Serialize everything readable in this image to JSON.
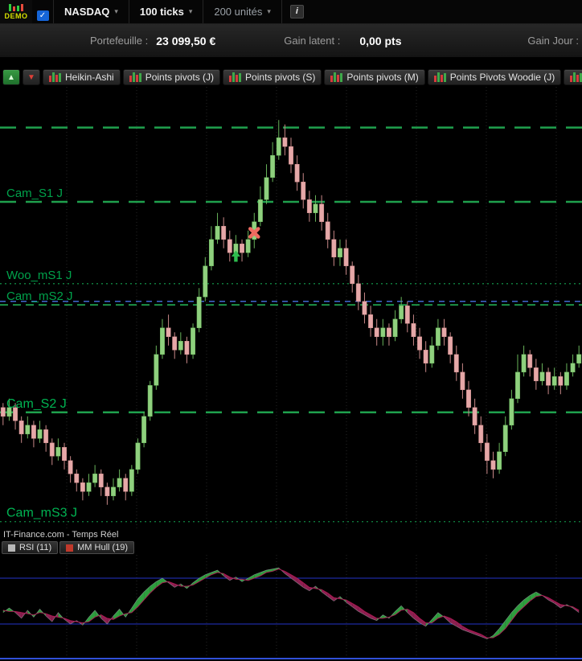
{
  "toolbar": {
    "demo_label": "DEMO",
    "status_icon": "✓",
    "instrument": "NASDAQ",
    "timeframe": "100 ticks",
    "quantity": "200 unités",
    "caret": "▾",
    "info_icon": "i"
  },
  "account": {
    "portfolio_label": "Portefeuille :",
    "portfolio_value": "23 099,50 €",
    "gain_label": "Gain latent :",
    "gain_value": "0,00 pts",
    "day_gain_label": "Gain Jour :"
  },
  "indicator_bar": {
    "up_icon": "▲",
    "down_icon": "▼",
    "buttons": [
      "Heikin-Ashi",
      "Points pivots (J)",
      "Points pivots (S)",
      "Points pivots (M)",
      "Points Pivots Woodie (J)",
      "P"
    ]
  },
  "watermark": "IT-Finance.com - Temps Réel",
  "legend": [
    {
      "label": "RSI (11)",
      "color": "#B8B8B8"
    },
    {
      "label": "MM Hull (19)",
      "color": "#C0392B"
    }
  ],
  "chart_data": {
    "type": "candlestick+oscillator",
    "price": {
      "type": "candlestick",
      "style": "heikin-ashi",
      "range": [
        0,
        100
      ],
      "up_color": "#8FD07E",
      "up_edge": "#68B35A",
      "down_color": "#E6A8A8",
      "down_edge": "#C88888",
      "grid_color": "#262626",
      "grid_start": 83,
      "grid_step": 87,
      "label_color": "#00A24B",
      "label_em_color": "#00B352",
      "level_styles": {
        "long": {
          "color": "#1FA04D",
          "width": 2.5,
          "dash": "20 12"
        },
        "dash": {
          "color": "#1FA04D",
          "width": 1.8,
          "dash": "10 6"
        },
        "dotted": {
          "color": "#0F7A3C",
          "width": 1.4,
          "dash": "2 4"
        },
        "blue": {
          "color": "#4169CF",
          "width": 1.5,
          "dash": "7 6"
        }
      },
      "levels": [
        {
          "label": "",
          "price": 91.3,
          "style": "long"
        },
        {
          "label": "Cam_S1 J",
          "price": 74.5,
          "style": "long"
        },
        {
          "label": "Woo_mS1 J",
          "price": 56.0,
          "style": "dotted"
        },
        {
          "label": "Cam_mS2 J",
          "price": 51.2,
          "style": "dash"
        },
        {
          "label": "",
          "price": 52.0,
          "style": "blue"
        },
        {
          "label": "Cam_S2 J",
          "price": 26.9,
          "style": "long",
          "em": true
        },
        {
          "label": "Cam_mS3 J",
          "price": 2.2,
          "style": "dotted",
          "em": true
        }
      ],
      "markers": [
        {
          "shape": "arrow-up",
          "color": "#2EBD4E",
          "index": 38,
          "price": 62.5
        },
        {
          "shape": "cross",
          "color": "#EE6B60",
          "index": 41,
          "price": 67.5
        }
      ],
      "candles": [
        [
          28,
          29,
          24,
          26
        ],
        [
          26,
          30,
          25,
          28
        ],
        [
          28,
          29,
          23,
          25
        ],
        [
          25,
          26,
          20,
          22
        ],
        [
          22,
          26,
          21,
          24
        ],
        [
          24,
          25,
          19,
          21
        ],
        [
          21,
          25,
          20,
          23
        ],
        [
          23,
          24,
          18,
          20
        ],
        [
          20,
          21,
          15,
          17
        ],
        [
          17,
          21,
          16,
          19
        ],
        [
          19,
          20,
          14,
          16
        ],
        [
          16,
          17,
          11,
          13
        ],
        [
          13,
          14,
          9,
          11
        ],
        [
          11,
          12,
          7,
          9
        ],
        [
          9,
          13,
          8,
          11
        ],
        [
          11,
          15,
          10,
          13
        ],
        [
          13,
          14,
          8,
          10
        ],
        [
          10,
          11,
          6,
          8
        ],
        [
          8,
          12,
          7,
          10
        ],
        [
          10,
          14,
          9,
          12
        ],
        [
          12,
          13,
          7,
          9
        ],
        [
          9,
          15,
          8,
          14
        ],
        [
          14,
          21,
          13,
          20
        ],
        [
          20,
          27,
          19,
          26
        ],
        [
          26,
          34,
          25,
          33
        ],
        [
          33,
          42,
          32,
          40
        ],
        [
          40,
          48,
          39,
          46
        ],
        [
          46,
          49,
          42,
          44
        ],
        [
          44,
          45,
          39,
          41
        ],
        [
          41,
          45,
          40,
          43
        ],
        [
          43,
          44,
          38,
          40
        ],
        [
          40,
          47,
          39,
          46
        ],
        [
          46,
          55,
          45,
          53
        ],
        [
          53,
          62,
          52,
          60
        ],
        [
          60,
          69,
          59,
          66
        ],
        [
          66,
          72,
          65,
          69
        ],
        [
          69,
          71,
          64,
          66
        ],
        [
          66,
          68,
          61,
          63
        ],
        [
          63,
          67,
          62,
          65
        ],
        [
          65,
          66,
          61,
          63
        ],
        [
          63,
          68,
          62,
          66
        ],
        [
          66,
          72,
          64,
          70
        ],
        [
          70,
          78,
          69,
          75
        ],
        [
          75,
          83,
          74,
          80
        ],
        [
          80,
          88,
          79,
          85
        ],
        [
          85,
          93,
          84,
          89
        ],
        [
          89,
          92,
          85,
          87
        ],
        [
          87,
          89,
          81,
          83
        ],
        [
          83,
          85,
          77,
          79
        ],
        [
          79,
          81,
          73,
          75
        ],
        [
          75,
          77,
          70,
          72
        ],
        [
          72,
          76,
          70,
          74
        ],
        [
          74,
          76,
          68,
          70
        ],
        [
          70,
          72,
          64,
          66
        ],
        [
          66,
          68,
          60,
          62
        ],
        [
          62,
          66,
          60,
          64
        ],
        [
          64,
          66,
          58,
          60
        ],
        [
          60,
          61,
          54,
          56
        ],
        [
          56,
          58,
          50,
          52
        ],
        [
          52,
          54,
          47,
          49
        ],
        [
          49,
          51,
          44,
          46
        ],
        [
          46,
          48,
          42,
          44
        ],
        [
          44,
          48,
          42,
          46
        ],
        [
          46,
          47,
          42,
          44
        ],
        [
          44,
          50,
          43,
          48
        ],
        [
          48,
          53,
          47,
          51
        ],
        [
          51,
          52,
          45,
          47
        ],
        [
          47,
          49,
          42,
          44
        ],
        [
          44,
          46,
          39,
          41
        ],
        [
          41,
          43,
          36,
          38
        ],
        [
          38,
          44,
          37,
          42
        ],
        [
          42,
          48,
          41,
          46
        ],
        [
          46,
          48,
          42,
          44
        ],
        [
          44,
          45,
          38,
          40
        ],
        [
          40,
          42,
          34,
          36
        ],
        [
          36,
          38,
          30,
          32
        ],
        [
          32,
          34,
          26,
          28
        ],
        [
          28,
          30,
          22,
          24
        ],
        [
          24,
          26,
          18,
          20
        ],
        [
          20,
          22,
          13,
          16
        ],
        [
          16,
          18,
          12,
          14
        ],
        [
          14,
          20,
          13,
          18
        ],
        [
          18,
          26,
          17,
          24
        ],
        [
          24,
          32,
          23,
          30
        ],
        [
          30,
          40,
          29,
          36
        ],
        [
          36,
          42,
          35,
          40
        ],
        [
          40,
          41,
          35,
          37
        ],
        [
          37,
          39,
          32,
          34
        ],
        [
          34,
          38,
          33,
          36
        ],
        [
          36,
          37,
          31,
          33
        ],
        [
          33,
          37,
          32,
          35
        ],
        [
          35,
          36,
          31,
          33
        ],
        [
          33,
          38,
          32,
          36
        ],
        [
          36,
          40,
          35,
          38
        ],
        [
          38,
          42,
          37,
          40
        ]
      ]
    },
    "oscillator": {
      "type": "area-band",
      "range": [
        0,
        100
      ],
      "levels": [
        70,
        30
      ],
      "level_color": "#2433C8",
      "up_fill": "#2E9E3E",
      "down_fill": "#8C2050",
      "rsi_line": "#A8ADB3",
      "hull_line": "#C2185B",
      "series": [
        {
          "name": "RSI (11)",
          "values": [
            40,
            44,
            40,
            35,
            42,
            36,
            43,
            37,
            32,
            40,
            34,
            30,
            33,
            29,
            36,
            42,
            35,
            30,
            37,
            43,
            36,
            44,
            52,
            58,
            63,
            67,
            70,
            66,
            62,
            65,
            61,
            66,
            70,
            73,
            75,
            77,
            72,
            68,
            71,
            67,
            70,
            73,
            75,
            77,
            78,
            79,
            74,
            70,
            66,
            62,
            59,
            63,
            58,
            54,
            50,
            54,
            49,
            45,
            41,
            38,
            35,
            33,
            38,
            35,
            41,
            46,
            40,
            35,
            31,
            28,
            34,
            40,
            36,
            31,
            28,
            25,
            23,
            21,
            19,
            17,
            20,
            26,
            33,
            40,
            46,
            51,
            55,
            58,
            55,
            51,
            48,
            44,
            47,
            44,
            40
          ]
        },
        {
          "name": "MM Hull (19)",
          "values": [
            42,
            41,
            41,
            40,
            39,
            38,
            40,
            39,
            37,
            36,
            35,
            33,
            32,
            31,
            32,
            36,
            38,
            35,
            34,
            37,
            39,
            40,
            45,
            51,
            57,
            62,
            66,
            67,
            65,
            63,
            63,
            64,
            67,
            70,
            73,
            75,
            74,
            71,
            69,
            69,
            68,
            70,
            72,
            75,
            76,
            78,
            76,
            73,
            70,
            66,
            62,
            61,
            60,
            57,
            53,
            52,
            51,
            48,
            45,
            41,
            38,
            35,
            35,
            36,
            38,
            42,
            43,
            40,
            35,
            31,
            31,
            35,
            37,
            35,
            32,
            28,
            25,
            23,
            21,
            18,
            18,
            21,
            26,
            33,
            40,
            45,
            50,
            54,
            55,
            53,
            50,
            47,
            46,
            45,
            42
          ]
        }
      ]
    }
  }
}
